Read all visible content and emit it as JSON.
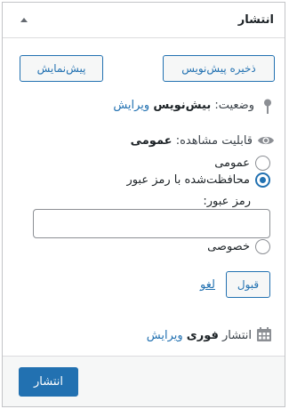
{
  "header": {
    "title": "انتشار"
  },
  "actions": {
    "save_draft_label": "ذخیره پیش‌نویس",
    "preview_label": "پیش‌نمایش"
  },
  "status": {
    "label": "وضعیت:",
    "value": "بیش‌نویس",
    "edit_link": "ویرایش",
    "icon": "pin-icon"
  },
  "visibility": {
    "label": "قابلیت مشاهده:",
    "value": "عمومی",
    "icon": "eye-icon",
    "options": [
      {
        "label": "عمومی",
        "checked": false
      },
      {
        "label": "محافظت‌شده با رمز عبور",
        "checked": true
      },
      {
        "label": "خصوصی",
        "checked": false
      }
    ],
    "password_label": "رمز عبور:",
    "password_value": "",
    "ok_label": "قبول",
    "cancel_link": "لغو"
  },
  "publish_time": {
    "label": "انتشار",
    "value": "فوری",
    "edit_link": "ویرایش",
    "icon": "calendar-icon"
  },
  "footer": {
    "publish_label": "انتشار"
  },
  "colors": {
    "accent": "#2271b1",
    "border": "#c3c4c7",
    "footer_bg": "#f6f7f7"
  }
}
